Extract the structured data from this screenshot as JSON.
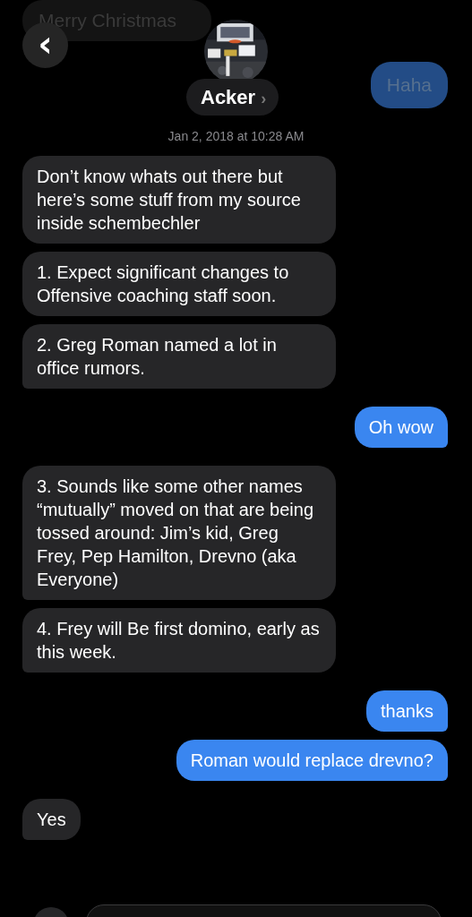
{
  "header": {
    "back_icon": "‹",
    "contact_name": "Acker",
    "chevron": "›",
    "faded_messages": [
      {
        "kind": "in",
        "text": "Merry Christmas"
      },
      {
        "kind": "out",
        "text": "Haha"
      }
    ]
  },
  "timestamp": "Jan 2, 2018 at 10:28 AM",
  "messages": [
    {
      "kind": "in",
      "text": "Don’t know whats out there but here’s some stuff from my source inside schembechler",
      "tail": false
    },
    {
      "kind": "in",
      "text": "1. Expect significant changes to Offensive coaching staff soon.",
      "tail": false
    },
    {
      "kind": "in",
      "text": "2. Greg Roman named a lot in office rumors.",
      "tail": true
    },
    {
      "kind": "out",
      "text": "Oh wow",
      "tail": true
    },
    {
      "kind": "in",
      "text": "3. Sounds like some other names “mutually” moved on that are being tossed around: Jim’s kid, Greg Frey, Pep Hamilton, Drevno (aka Everyone)",
      "tail": true
    },
    {
      "kind": "in",
      "text": "4. Frey will Be first domino, early as this week.",
      "tail": true
    },
    {
      "kind": "out",
      "text": "thanks",
      "tail": true
    },
    {
      "kind": "out",
      "text": "Roman would replace drevno?",
      "tail": true
    },
    {
      "kind": "in",
      "text": "Yes",
      "tail": true
    }
  ]
}
